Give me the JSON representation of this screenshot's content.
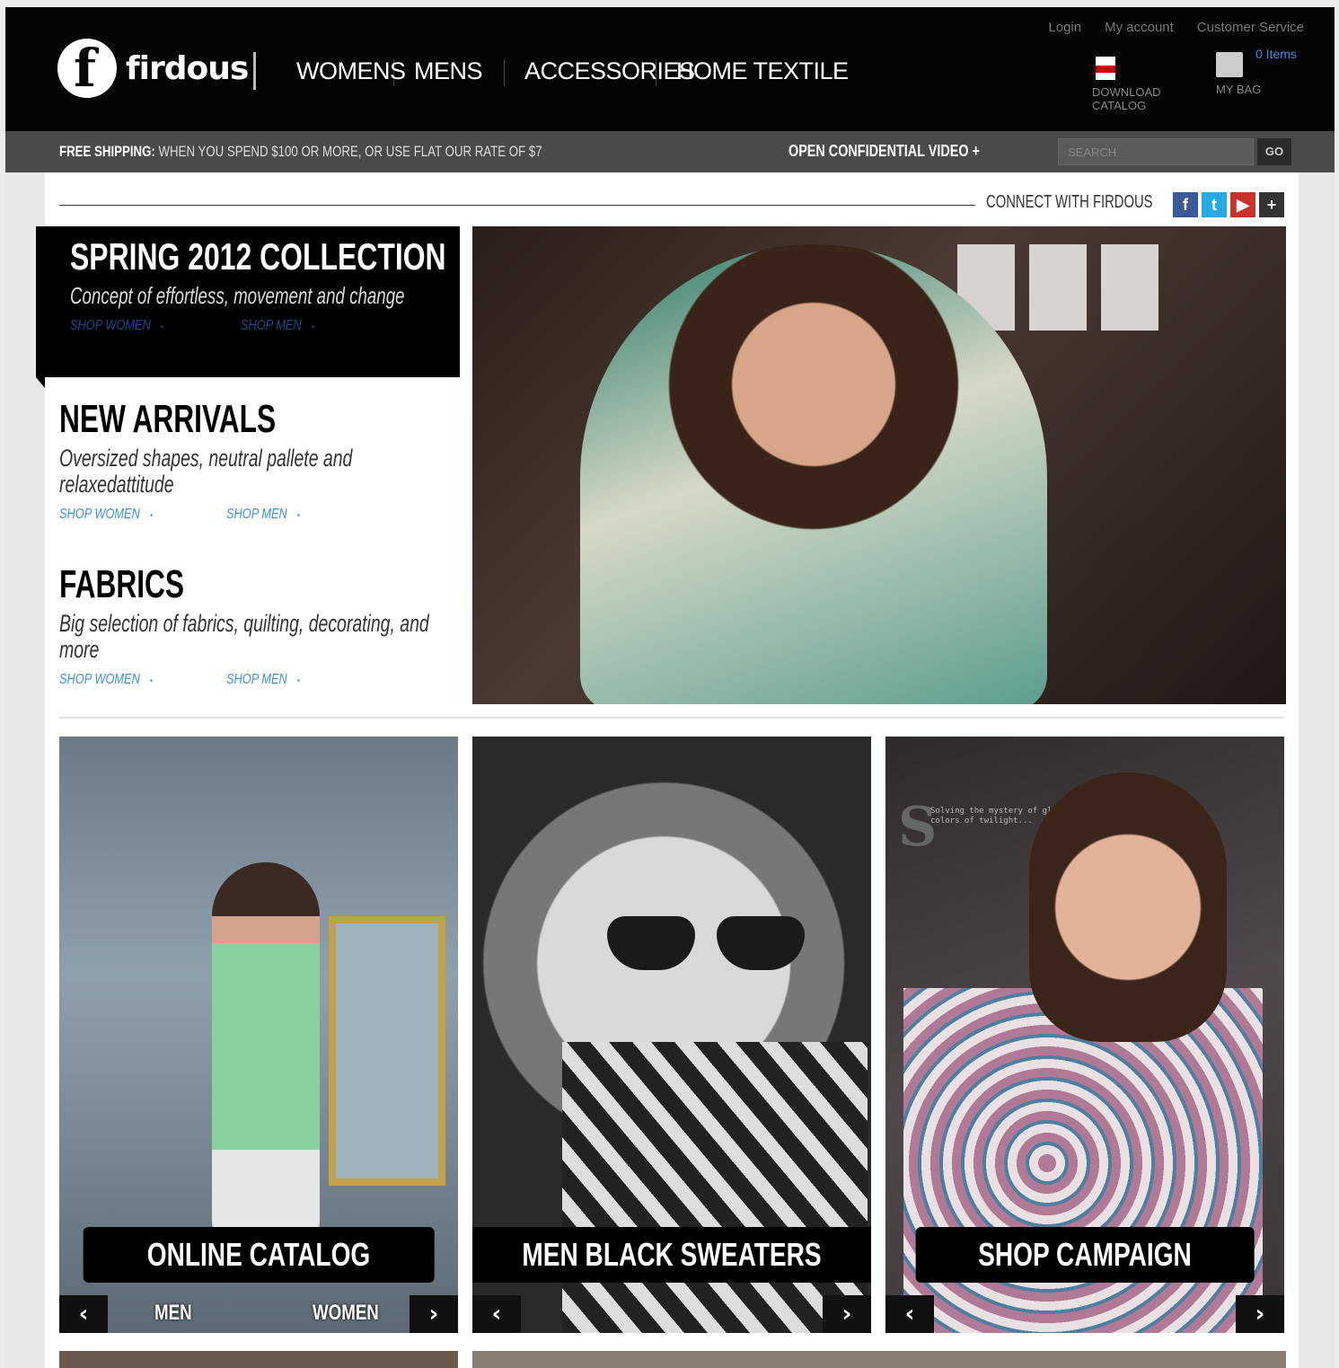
{
  "header": {
    "brand": "firdous",
    "nav": [
      "WOMENS",
      "MENS",
      "ACCESSORIES",
      "HOME TEXTILE"
    ],
    "top_links": [
      "Login",
      "My account",
      "Customer Service"
    ],
    "download_label_1": "DOWNLOAD",
    "download_label_2": "CATALOG",
    "bag_label": "MY BAG",
    "bag_count": "0 Items"
  },
  "promo": {
    "prefix": "FREE SHIPPING:",
    "text": "WHEN YOU SPEND $100 OR MORE, OR USE FLAT OUR RATE OF $7",
    "video_link": "OPEN CONFIDENTIAL VIDEO +",
    "search_placeholder": "SEARCH",
    "go": "GO"
  },
  "connect": {
    "label": "CONNECT WITH FIRDOUS",
    "icons": [
      "facebook-icon",
      "twitter-icon",
      "youtube-icon",
      "plus-icon"
    ]
  },
  "feature": {
    "title": "SPRING 2012 COLLECTION",
    "tagline": "Concept of effortless, movement and change",
    "shop_women": "SHOP WOMEN",
    "shop_men": "SHOP MEN"
  },
  "new_arrivals": {
    "title": "NEW ARRIVALS",
    "desc": "Oversized shapes, neutral pallete and relaxedattitude",
    "shop_women": "SHOP WOMEN",
    "shop_men": "SHOP MEN"
  },
  "fabrics": {
    "title": "FABRICS",
    "desc": "Big selection of fabrics, quilting, decorating, and more",
    "shop_women": "SHOP WOMEN",
    "shop_men": "SHOP MEN"
  },
  "tiles": [
    {
      "banner": "ONLINE CATALOG",
      "sub_left": "MEN",
      "sub_right": "WOMEN"
    },
    {
      "banner": "MEN BLACK SWEATERS"
    },
    {
      "banner": "SHOP CAMPAIGN",
      "overlay": "Solving the mystery of glowing colors of twilight..."
    }
  ],
  "colors": {
    "header_bg": "#050505",
    "promo_bg": "#4a4a4a",
    "link_blue": "#3a8ee6",
    "dark_link_blue": "#1d4b8a"
  }
}
